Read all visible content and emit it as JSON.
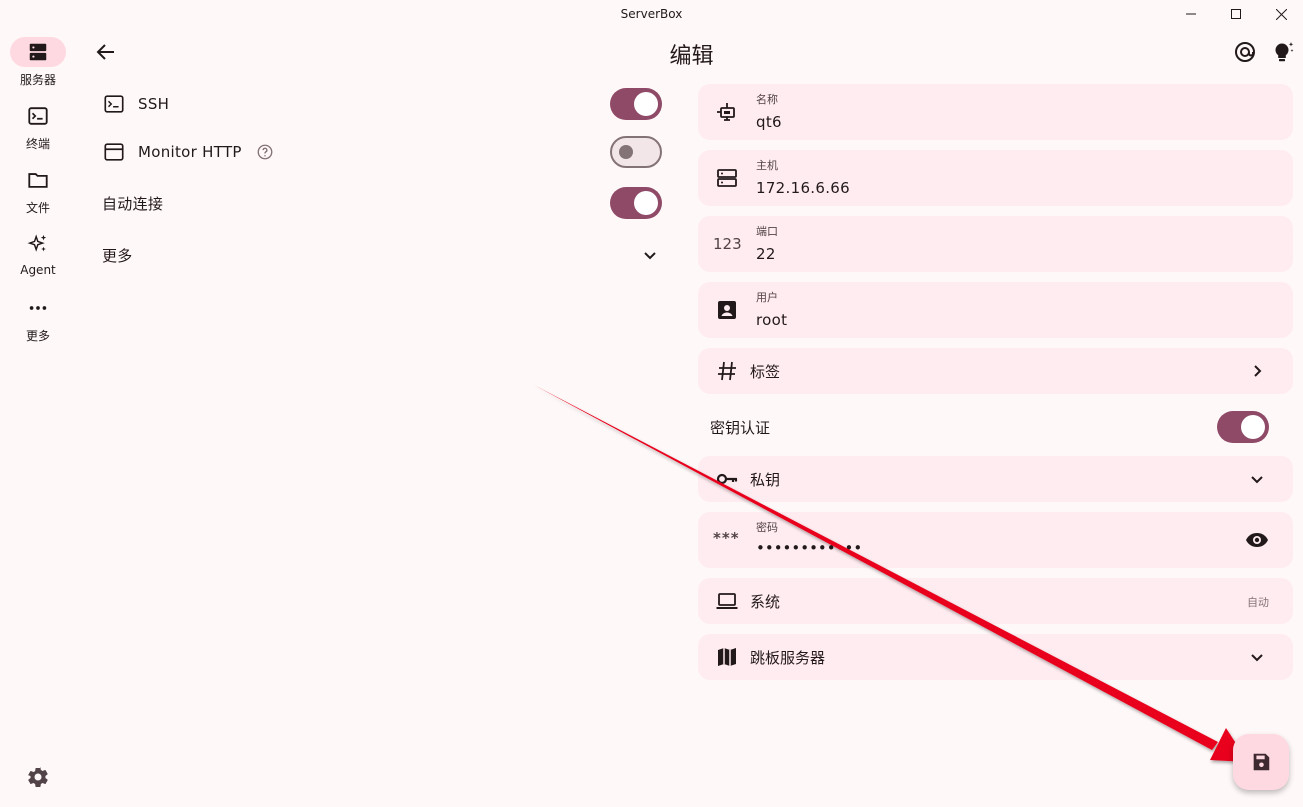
{
  "window": {
    "title": "ServerBox"
  },
  "rail": {
    "items": [
      {
        "label": "服务器",
        "icon": "server-icon",
        "active": true
      },
      {
        "label": "终端",
        "icon": "terminal-icon"
      },
      {
        "label": "文件",
        "icon": "folder-icon"
      },
      {
        "label": "Agent",
        "icon": "sparkle-icon"
      },
      {
        "label": "更多",
        "icon": "more-horiz-icon"
      }
    ],
    "settings_icon": "gear-icon"
  },
  "header": {
    "title": "编辑"
  },
  "left": {
    "ssh_label": "SSH",
    "monitor_http_label": "Monitor HTTP",
    "auto_connect_label": "自动连接",
    "more_label": "更多",
    "ssh_enabled": true,
    "monitor_http_enabled": false,
    "auto_connect_enabled": true
  },
  "form": {
    "name_label": "名称",
    "name_value": "qt6",
    "host_label": "主机",
    "host_value": "172.16.6.66",
    "port_icon_text": "123",
    "port_label": "端口",
    "port_value": "22",
    "user_label": "用户",
    "user_value": "root",
    "tags_label": "标签",
    "key_auth_label": "密钥认证",
    "key_auth_enabled": true,
    "private_key_label": "私钥",
    "password_icon_text": "***",
    "password_label": "密码",
    "password_value": "••••••••••••",
    "system_label": "系统",
    "system_value": "自动",
    "jump_server_label": "跳板服务器"
  },
  "colors": {
    "background": "#fff8f8",
    "card": "#ffecf0",
    "accent": "#8f4a68",
    "rail_active": "#ffd9e1",
    "annotation_arrow": "#e8001c"
  }
}
